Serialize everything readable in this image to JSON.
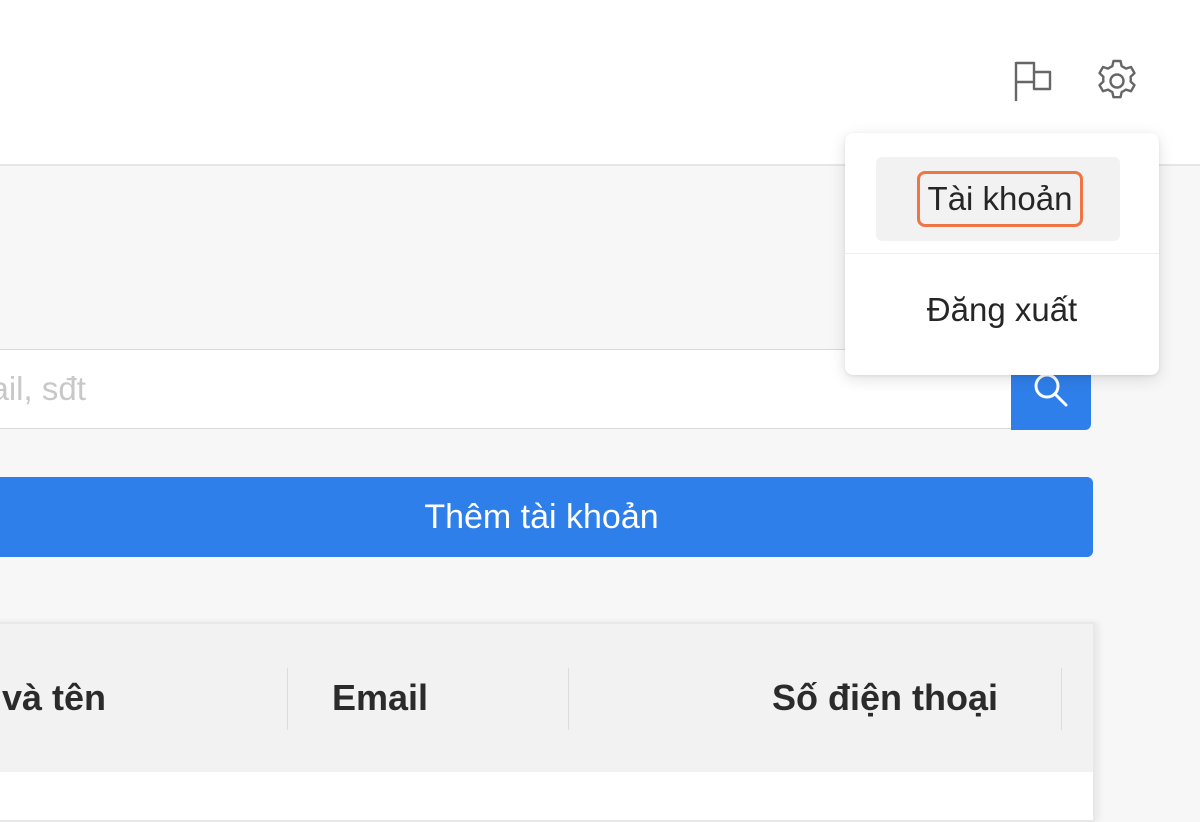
{
  "header": {
    "icons": [
      "flag-icon",
      "gear-icon"
    ]
  },
  "search": {
    "placeholder": "mail, sđt",
    "value": ""
  },
  "actions": {
    "add_account_label": "Thêm tài khoản"
  },
  "table": {
    "columns": [
      "và tên",
      "Email",
      "Số điện thoại"
    ]
  },
  "dropdown": {
    "items": [
      {
        "label": "Tài khoản"
      },
      {
        "label": "Đăng xuất"
      }
    ]
  },
  "colors": {
    "primary": "#2f7fea",
    "highlight": "#f07545",
    "header_bg": "#ffffff",
    "page_bg": "#f7f7f7"
  }
}
